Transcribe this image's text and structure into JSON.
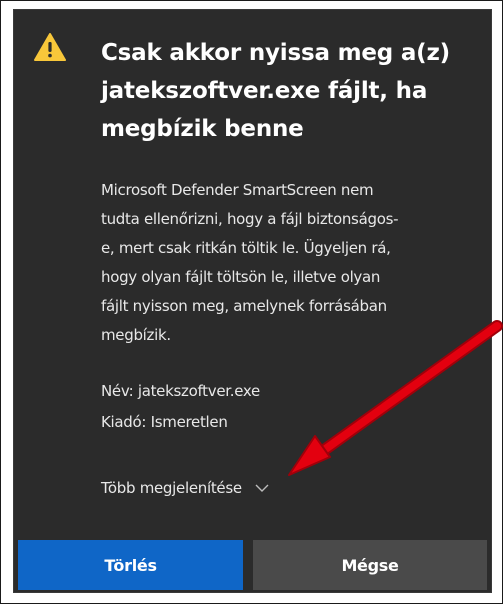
{
  "dialog": {
    "title": "Csak akkor nyissa meg a(z) jatekszoftver.exe fájlt, ha megbízik benne",
    "title_lines": [
      "Csak akkor nyissa meg a(z)",
      "jatekszoftver.exe fájlt, ha",
      "megbízik benne"
    ],
    "body_lines": [
      "Microsoft Defender SmartScreen nem",
      "tudta ellenőrizni, hogy a fájl biztonságos-",
      "e, mert csak ritkán töltik le. Ügyeljen rá,",
      "hogy olyan fájlt töltsön le, illetve olyan",
      "fájlt nyisson meg, amelynek forrásában",
      "megbízik."
    ],
    "name_line": "Név: jatekszoftver.exe",
    "publisher_line": "Kiadó: Ismeretlen",
    "more_label": "Több megjelenítése",
    "delete_label": "Törlés",
    "cancel_label": "Mégse"
  },
  "icons": {
    "warning": "warning-icon",
    "chevron": "chevron-down-icon"
  },
  "colors": {
    "dialog_bg": "#2b2b2b",
    "primary_button": "#0f66c7",
    "secondary_button": "#4a4a4a",
    "warning_yellow": "#f8c73a",
    "annotation_arrow": "#e3000f"
  }
}
